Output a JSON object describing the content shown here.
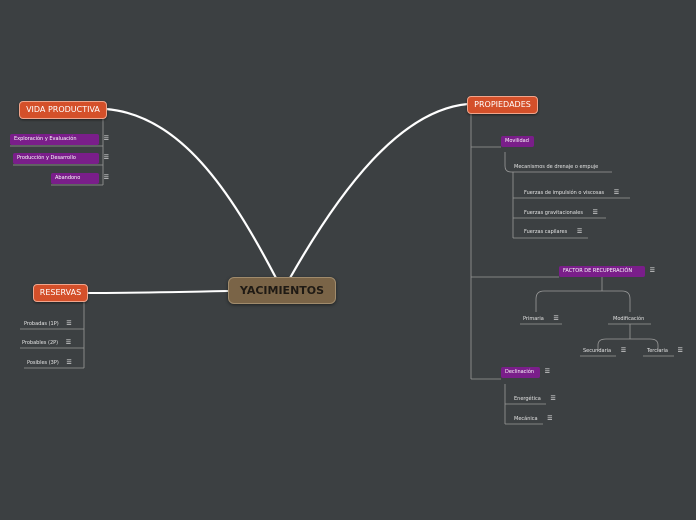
{
  "root": {
    "label": "YACIMIENTOS"
  },
  "vida_productiva": {
    "label": "VIDA PRODUCTIVA",
    "items": [
      {
        "label": "Exploración y Evaluación"
      },
      {
        "label": "Producción y Desarrollo"
      },
      {
        "label": "Abandono"
      }
    ]
  },
  "reservas": {
    "label": "RESERVAS",
    "items": [
      {
        "label": "Probadas (1P)"
      },
      {
        "label": "Probables (2P)"
      },
      {
        "label": "Posibles (3P)"
      }
    ]
  },
  "propiedades": {
    "label": "PROPIEDADES",
    "movilidad": {
      "label": "Movilidad",
      "mecanismos": {
        "label": "Mecanismos de drenaje o empuje",
        "items": [
          {
            "label": "Fuerzas de impulsión o viscosas"
          },
          {
            "label": "Fuerzas gravitacionales"
          },
          {
            "label": "Fuerzas capilares"
          }
        ]
      }
    },
    "factor": {
      "label": "FACTOR DE RECUPERACIÓN",
      "primaria": "Primaria",
      "modificacion": {
        "label": "Modificación",
        "secundaria": "Secundaria",
        "terciaria": "Terciaria"
      }
    },
    "declinacion": {
      "label": "Declinación",
      "items": [
        {
          "label": "Energética"
        },
        {
          "label": "Mecánica"
        }
      ]
    }
  },
  "note_glyph": "☰",
  "colors": {
    "background": "#3c4042",
    "root": "#7a6447",
    "main_topic": "#d4502a",
    "subtopic": "#7a1e8a",
    "connector": "#ffffff",
    "leaf_line": "#9a9a9a"
  }
}
